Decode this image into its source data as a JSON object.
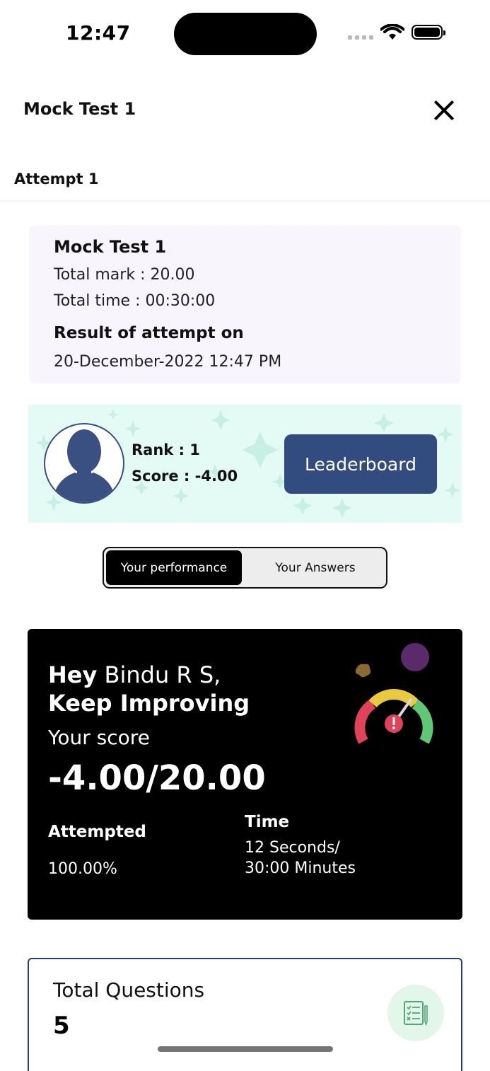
{
  "status_bar": {
    "time": "12:47"
  },
  "header": {
    "title": "Mock Test 1",
    "attempt_label": "Attempt 1"
  },
  "info_card": {
    "test_name": "Mock Test 1",
    "total_mark": "Total mark : 20.00",
    "total_time": "Total time : 00:30:00",
    "result_label": "Result of attempt on",
    "result_date": "20-December-2022 12:47 PM"
  },
  "rank_banner": {
    "rank": "Rank :  1",
    "score": "Score : -4.00",
    "leaderboard_label": "Leaderboard"
  },
  "tabs": {
    "performance": "Your performance",
    "answers": "Your Answers"
  },
  "performance": {
    "greeting_prefix": "Hey",
    "user_name": " Bindu R S,",
    "encouragement": "Keep Improving",
    "your_score_label": "Your score",
    "score": "-4.00/20.00",
    "attempted_label": "Attempted",
    "attempted_value": "100.00%",
    "time_label": "Time",
    "time_value_line1": "12 Seconds/",
    "time_value_line2": "30:00 Minutes"
  },
  "total_questions": {
    "label": "Total Questions",
    "value": "5"
  },
  "colors": {
    "accent_blue": "#334c7f",
    "banner_bg": "#e3fbf4",
    "info_bg": "#f8f5fc",
    "gauge_red": "#e0425a",
    "gauge_yellow": "#e9c93d",
    "gauge_green": "#5fc776"
  }
}
